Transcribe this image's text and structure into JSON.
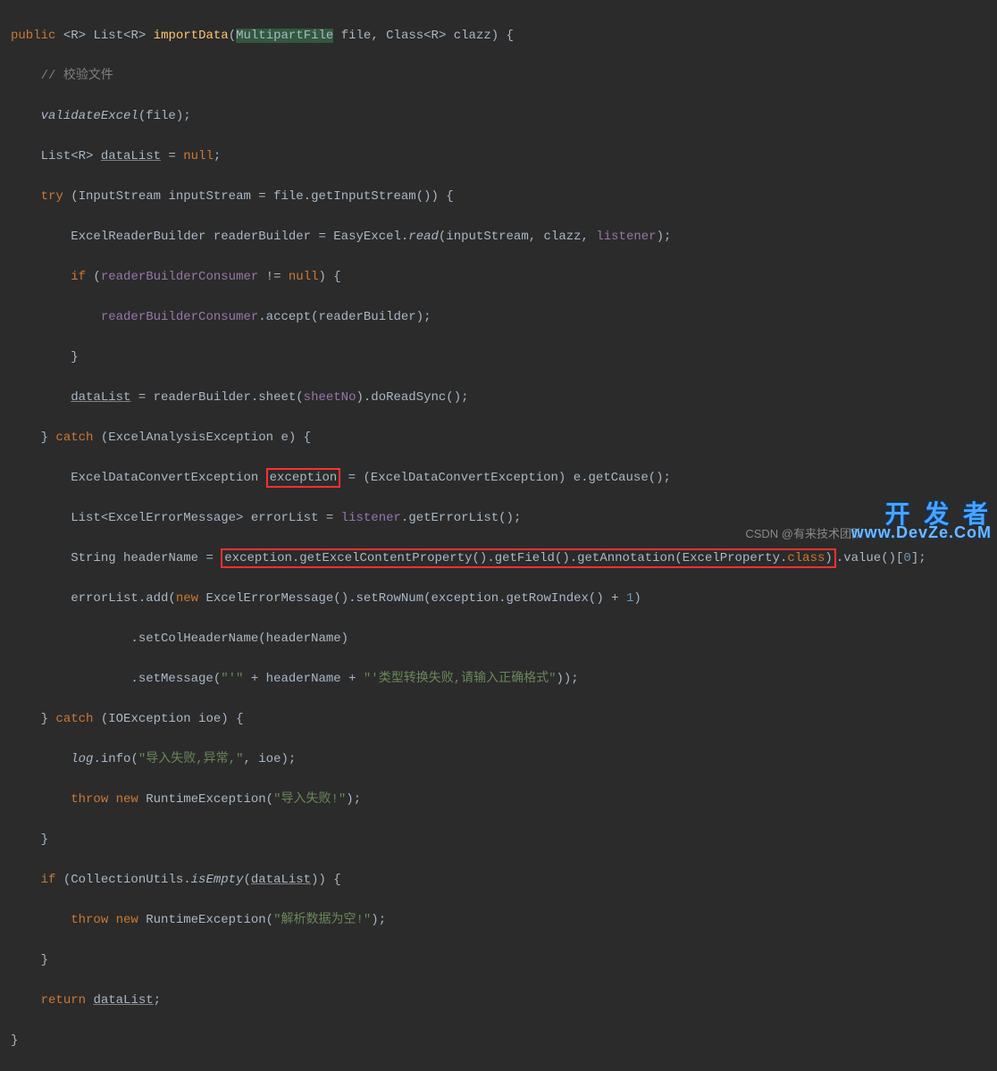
{
  "code": {
    "l1_public": "public",
    "l1_generic": "<R>",
    "l1_list": " List<R> ",
    "l1_method": "importData",
    "l1_open": "(",
    "l1_mp_pre": "Multip",
    "l1_mp_post": "artFile",
    "l1_file": " file, Class<R> clazz) {",
    "l2_comment": "// 校验文件",
    "l3_validate": "validateExcel",
    "l3_args": "(file);",
    "l4_list": "List<R> ",
    "l4_datalist": "dataList",
    "l4_eq": " = ",
    "l4_null": "null",
    "l4_semi": ";",
    "l5_try": "try",
    "l5_rest": " (InputStream ",
    "l5_is": "inputStream",
    "l5_eq": " = file.getInputStream()) {",
    "l6_pre": "ExcelReaderBuilder ",
    "l6_rb": "readerBuilder",
    "l6_eq": " = EasyExcel.",
    "l6_read": "read",
    "l6_args": "(inputStream, clazz, ",
    "l6_listener": "listener",
    "l6_close": ");",
    "l7_if": "if",
    "l7_cond": " (",
    "l7_rbc": "readerBuilderConsumer",
    "l7_neq": " != ",
    "l7_null": "null",
    "l7_open": ") {",
    "l8_rbc": "readerBuilderConsumer",
    "l8_accept": ".accept(readerBuilder);",
    "l9_brace": "}",
    "l10_dl": "dataList",
    "l10_rest": " = readerBuilder.sheet(",
    "l10_sheetno": "sheetNo",
    "l10_end": ").doReadSync();",
    "l11_close": "} ",
    "l11_catch": "catch",
    "l11_rest": " (ExcelAnalysisException e) {",
    "l12_pre": "ExcelDataConvertException ",
    "l12_exception": "exception",
    "l12_rest": " = (ExcelDataConvertException) e.getCause();",
    "l13_pre": "List<ExcelErrorMessage> ",
    "l13_el": "errorList",
    "l13_rest": " = ",
    "l13_listener": "listener",
    "l13_get": ".getErrorList();",
    "l14_pre": "String ",
    "l14_hn": "headerName",
    "l14_eq": " = ",
    "l14_chain": "exception.getExcelContentProperty().getField().getAnnotation(",
    "l14_ep": "ExcelProperty",
    "l14_class": ".",
    "l14_classkw": "class",
    "l14_close": ")",
    "l14_value": ".value()[",
    "l14_zero": "0",
    "l14_end": "];",
    "l15_pre": "errorList.add(",
    "l15_new": "new",
    "l15_eem": " ExcelErrorMessage().setRowNum(exception.getRowIndex() + ",
    "l15_one": "1",
    "l15_close": ")",
    "l16_chain": ".setColHeaderName(headerName)",
    "l17_pre": ".setMessage(",
    "l17_q1": "\"'\"",
    "l17_plus1": " + headerName + ",
    "l17_q2": "\"'类型转换失败,请输入正确格式\"",
    "l17_end": "));",
    "l18_close": "} ",
    "l18_catch": "catch",
    "l18_rest": " (IOException ioe) {",
    "l19_log": "log",
    "l19_info": ".info(",
    "l19_str": "\"导入失败,异常,\"",
    "l19_rest": ", ioe);",
    "l20_throw": "throw new",
    "l20_re": " RuntimeException(",
    "l20_str": "\"导入失败!\"",
    "l20_end": ");",
    "l21_brace": "}",
    "l22_if": "if",
    "l22_open": " (CollectionUtils.",
    "l22_isempty": "isEmpty",
    "l22_args": "(",
    "l22_dl": "dataList",
    "l22_close": ")) {",
    "l23_throw": "throw new",
    "l23_re": " RuntimeException(",
    "l23_str": "\"解析数据为空!\"",
    "l23_end": ");",
    "l24_brace": "}",
    "l25_return": "return",
    "l25_sp": " ",
    "l25_dl": "dataList",
    "l25_semi": ";",
    "l26_brace": "}"
  },
  "watermark": {
    "cn": "开 发 者",
    "en": "www.DevZe.CoM",
    "csdn": "CSDN @有来技术团队"
  }
}
